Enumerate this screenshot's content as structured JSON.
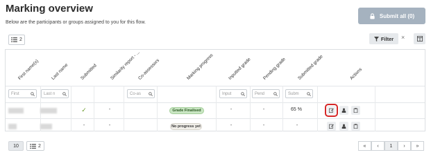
{
  "header": {
    "title": "Marking overview",
    "subtitle": "Below are the participants or groups assigned to you for this flow.",
    "submit_label": "Submit all (0)"
  },
  "toolbar": {
    "group_count": "2",
    "filter_label": "Filter",
    "clear_label": "×"
  },
  "table": {
    "headers": [
      "First name(s)",
      "Last name",
      "Submitted",
      "Similarity report - ...",
      "Co-assessors",
      "Marking progress",
      "Inputted grade",
      "Pending grade",
      "Submitted grade",
      "Actions"
    ],
    "filters": {
      "first": "First",
      "last": "Last n",
      "coassessor": "Co-as",
      "inputted": "Input",
      "pending": "Pend",
      "submitted": "Subm"
    },
    "rows": [
      {
        "submitted": "✓",
        "similarity": "-",
        "progress": "Grade Finalised",
        "inputted": "-",
        "pending": "-",
        "submitted_grade": "65 %"
      },
      {
        "submitted": "-",
        "similarity": "-",
        "progress": "No progress yet",
        "inputted": "-",
        "pending": "-",
        "submitted_grade": "-"
      }
    ]
  },
  "footer": {
    "page_size": "10",
    "group_count": "2",
    "first": "«",
    "prev": "‹",
    "page": "1",
    "next": "›",
    "last": "»"
  },
  "colors": {
    "submit_disabled": "#a5b2bf",
    "finalised_badge": "#c9e6c3",
    "highlight": "#d62828",
    "check": "#6a9a2a"
  },
  "icons": [
    "lock-icon",
    "list-icon",
    "filter-icon",
    "columns-icon",
    "search-icon",
    "edit-icon",
    "user-icon",
    "clipboard-icon"
  ]
}
